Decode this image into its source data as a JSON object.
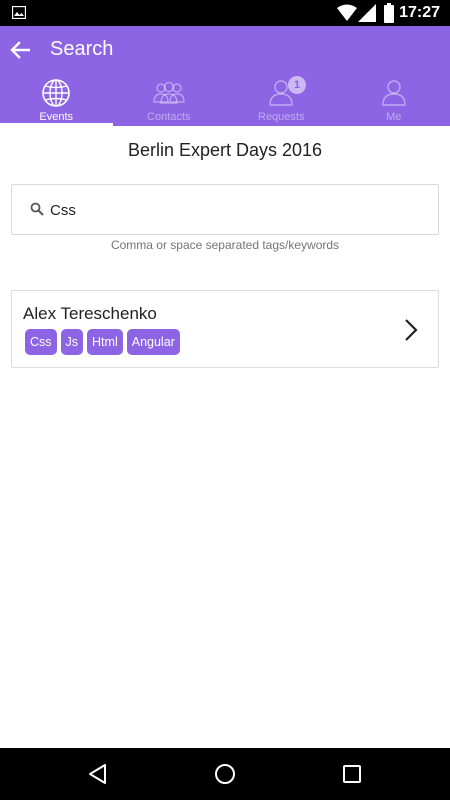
{
  "status_bar": {
    "time": "17:27",
    "icons": [
      "gallery-icon",
      "wifi-icon",
      "signal-icon",
      "battery-icon"
    ]
  },
  "app_bar": {
    "title": "Search",
    "color": "#8c64e4"
  },
  "tabs": [
    {
      "label": "Events",
      "icon": "globe-icon",
      "active": true
    },
    {
      "label": "Contacts",
      "icon": "contacts-icon",
      "active": false
    },
    {
      "label": "Requests",
      "icon": "person-icon",
      "active": false,
      "badge": "1"
    },
    {
      "label": "Me",
      "icon": "person-icon",
      "active": false
    }
  ],
  "event": {
    "title": "Berlin Expert Days 2016"
  },
  "search": {
    "value": "Css",
    "hint": "Comma or space separated tags/keywords"
  },
  "results": [
    {
      "name": "Alex Tereschenko",
      "tags": [
        "Css",
        "Js",
        "Html",
        "Angular"
      ]
    }
  ],
  "nav_bar": {
    "icons": [
      "back-icon",
      "home-icon",
      "recents-icon"
    ]
  }
}
